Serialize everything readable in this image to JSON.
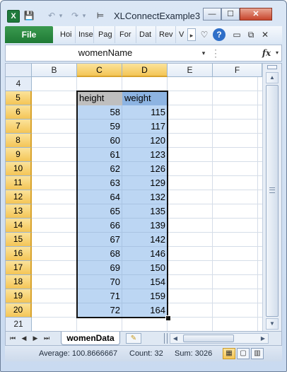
{
  "window": {
    "title": "XLConnectExample3",
    "app_icon": "X",
    "quick_access": {
      "save": "💾",
      "undo": "↶",
      "undo_drop": "▾",
      "redo": "↷",
      "redo_drop": "▾",
      "customize": "⊨"
    },
    "controls": {
      "minimize": "—",
      "maximize": "☐",
      "close": "✕"
    }
  },
  "ribbon": {
    "file_label": "File",
    "tabs": [
      "Hoi",
      "Inse",
      "Pag",
      "For",
      "Dat",
      "Rev",
      "V"
    ],
    "more": "▸",
    "icons": {
      "minimize_ribbon": "♡",
      "help": "?",
      "win_min": "▭",
      "win_restore": "⧉",
      "win_close": "✕"
    }
  },
  "formula_bar": {
    "name_box": "womenName",
    "dropdown": "▾",
    "separator": "⋮",
    "fx": "fx",
    "expand": "▾",
    "content": ""
  },
  "grid": {
    "columns": [
      "B",
      "C",
      "D",
      "E",
      "F"
    ],
    "selected_columns": [
      "C",
      "D"
    ],
    "rows": [
      "4",
      "5",
      "6",
      "7",
      "8",
      "9",
      "10",
      "11",
      "12",
      "13",
      "14",
      "15",
      "16",
      "17",
      "18",
      "19",
      "20",
      "21"
    ],
    "header_row": {
      "height": "height",
      "weight": "weight"
    },
    "data": [
      {
        "height": "58",
        "weight": "115"
      },
      {
        "height": "59",
        "weight": "117"
      },
      {
        "height": "60",
        "weight": "120"
      },
      {
        "height": "61",
        "weight": "123"
      },
      {
        "height": "62",
        "weight": "126"
      },
      {
        "height": "63",
        "weight": "129"
      },
      {
        "height": "64",
        "weight": "132"
      },
      {
        "height": "65",
        "weight": "135"
      },
      {
        "height": "66",
        "weight": "139"
      },
      {
        "height": "67",
        "weight": "142"
      },
      {
        "height": "68",
        "weight": "146"
      },
      {
        "height": "69",
        "weight": "150"
      },
      {
        "height": "70",
        "weight": "154"
      },
      {
        "height": "71",
        "weight": "159"
      },
      {
        "height": "72",
        "weight": "164"
      }
    ]
  },
  "scroll": {
    "up": "▲",
    "down": "▼",
    "left": "◀",
    "right": "▶"
  },
  "sheets": {
    "nav": [
      "⏮",
      "◀",
      "▶",
      "⏭"
    ],
    "active": "womenData",
    "new_sheet_icon": "✎"
  },
  "status": {
    "average": "Average: 100.8666667",
    "count": "Count: 32",
    "sum": "Sum: 3026",
    "views": {
      "normal": "▦",
      "page_layout": "▢",
      "page_break": "▥"
    }
  },
  "colors": {
    "selection": "#bcd6f3",
    "height_header": "#bfbfbf",
    "weight_header": "#8db4e2",
    "file_tab": "#1f7a35"
  }
}
